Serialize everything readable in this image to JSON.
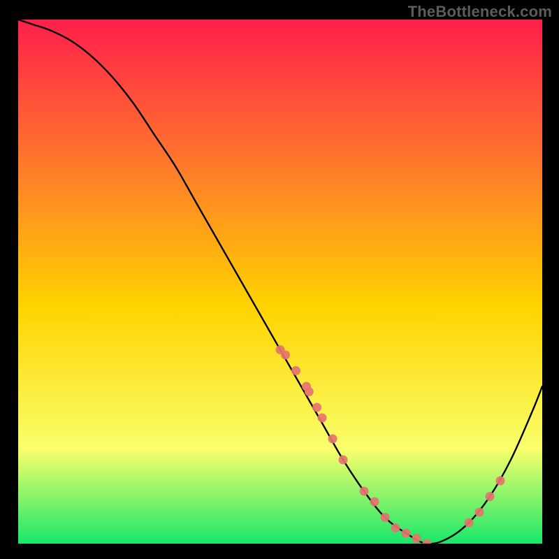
{
  "watermark": "TheBottleneck.com",
  "colors": {
    "gradient_top": "#ff1f4b",
    "gradient_mid_upper": "#ff7a2a",
    "gradient_mid": "#ffd400",
    "gradient_mid_lower": "#f9ff6b",
    "gradient_bottom": "#17e86a",
    "curve": "#000000",
    "marker": "#e6736e",
    "bg": "#000000"
  },
  "chart_data": {
    "type": "line",
    "title": "",
    "xlabel": "",
    "ylabel": "",
    "xlim": [
      0,
      100
    ],
    "ylim": [
      0,
      100
    ],
    "series": [
      {
        "name": "bottleneck-curve",
        "x": [
          0,
          3,
          6,
          10,
          14,
          18,
          22,
          26,
          30,
          34,
          38,
          42,
          46,
          50,
          54,
          58,
          62,
          66,
          70,
          74,
          78,
          82,
          86,
          90,
          94,
          98,
          100
        ],
        "y": [
          100,
          99,
          98,
          96,
          93,
          89,
          84,
          78,
          72,
          65,
          58,
          51,
          44,
          37,
          30,
          23,
          16,
          10,
          5,
          2,
          0,
          1,
          4,
          9,
          16,
          25,
          30
        ]
      }
    ],
    "markers": {
      "name": "highlight-points",
      "x": [
        50,
        51,
        53,
        55,
        55.5,
        57,
        58,
        60,
        62,
        66,
        68,
        70,
        72,
        74,
        76,
        78,
        86,
        88,
        90,
        92
      ],
      "y": [
        37,
        36,
        33,
        30,
        29,
        26,
        24,
        20,
        16,
        10,
        8,
        5,
        3,
        2,
        1,
        0,
        4,
        6,
        9,
        12
      ]
    }
  }
}
